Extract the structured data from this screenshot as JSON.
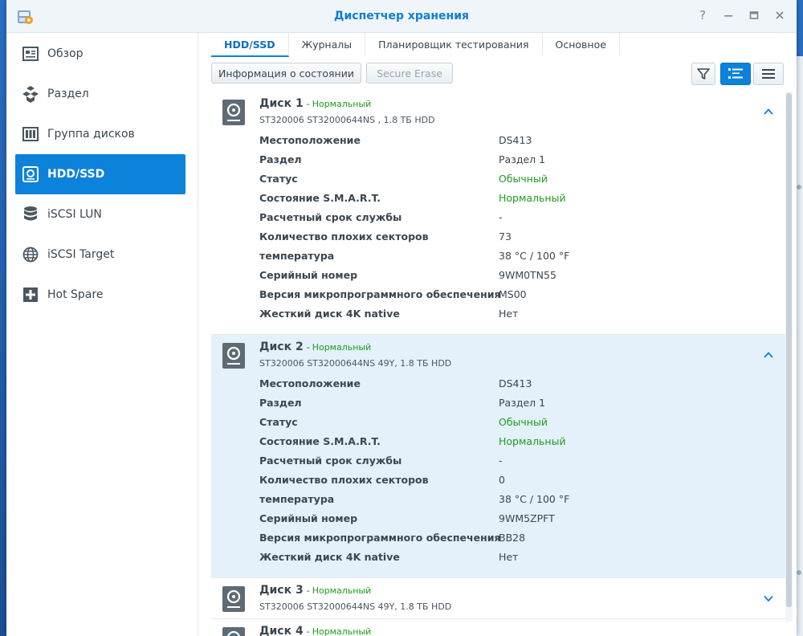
{
  "window": {
    "title": "Диспетчер хранения"
  },
  "sidebar": {
    "items": [
      {
        "label": "Обзор",
        "icon": "overview-icon"
      },
      {
        "label": "Раздел",
        "icon": "volume-icon"
      },
      {
        "label": "Группа дисков",
        "icon": "disk-group-icon"
      },
      {
        "label": "HDD/SSD",
        "icon": "hdd-icon",
        "active": true
      },
      {
        "label": "iSCSI LUN",
        "icon": "lun-icon"
      },
      {
        "label": "iSCSI Target",
        "icon": "target-icon"
      },
      {
        "label": "Hot Spare",
        "icon": "hot-spare-icon"
      }
    ]
  },
  "tabs": [
    {
      "label": "HDD/SSD",
      "active": true
    },
    {
      "label": "Журналы"
    },
    {
      "label": "Планировщик тестирования"
    },
    {
      "label": "Основное"
    }
  ],
  "toolbar": {
    "health_info": "Информация о состоянии",
    "secure_erase": "Secure Erase"
  },
  "disks": [
    {
      "name": "Диск 1",
      "dash": "-",
      "status": "Нормальный",
      "subtitle": "ST320006 ST32000644NS , 1.8 ТБ HDD",
      "expanded": true,
      "selected": false,
      "fields": [
        {
          "k": "Местоположение",
          "v": "DS413"
        },
        {
          "k": "Раздел",
          "v": "Раздел 1"
        },
        {
          "k": "Статус",
          "v": "Обычный",
          "green": true
        },
        {
          "k": "Состояние S.M.A.R.T.",
          "v": "Нормальный",
          "green": true
        },
        {
          "k": "Расчетный срок службы",
          "v": "-"
        },
        {
          "k": "Количество плохих секторов",
          "v": "73"
        },
        {
          "k": "температура",
          "v": "38 °C / 100 °F"
        },
        {
          "k": "Серийный номер",
          "v": "9WM0TN55"
        },
        {
          "k": "Версия микропрограммного обеспечения",
          "v": "MS00"
        },
        {
          "k": "Жесткий диск 4K native",
          "v": "Нет"
        }
      ]
    },
    {
      "name": "Диск 2",
      "dash": "-",
      "status": "Нормальный",
      "subtitle": "ST320006 ST32000644NS 49Y, 1.8 ТБ HDD",
      "expanded": true,
      "selected": true,
      "fields": [
        {
          "k": "Местоположение",
          "v": "DS413"
        },
        {
          "k": "Раздел",
          "v": "Раздел 1"
        },
        {
          "k": "Статус",
          "v": "Обычный",
          "green": true
        },
        {
          "k": "Состояние S.M.A.R.T.",
          "v": "Нормальный",
          "green": true
        },
        {
          "k": "Расчетный срок службы",
          "v": "-"
        },
        {
          "k": "Количество плохих секторов",
          "v": "0"
        },
        {
          "k": "температура",
          "v": "38 °C / 100 °F"
        },
        {
          "k": "Серийный номер",
          "v": "9WM5ZPFT"
        },
        {
          "k": "Версия микропрограммного обеспечения",
          "v": "BB28"
        },
        {
          "k": "Жесткий диск 4K native",
          "v": "Нет"
        }
      ]
    },
    {
      "name": "Диск 3",
      "dash": "-",
      "status": "Нормальный",
      "subtitle": "ST320006 ST32000644NS 49Y, 1.8 ТБ HDD",
      "expanded": false,
      "selected": false,
      "fields": []
    },
    {
      "name": "Диск 4",
      "dash": "-",
      "status": "Нормальный",
      "subtitle": "",
      "expanded": false,
      "selected": false,
      "fields": []
    }
  ],
  "colors": {
    "accent": "#0d82da",
    "title": "#0e7fd6",
    "ok": "#1b9e1b",
    "selected_row": "#e4f1fb"
  }
}
